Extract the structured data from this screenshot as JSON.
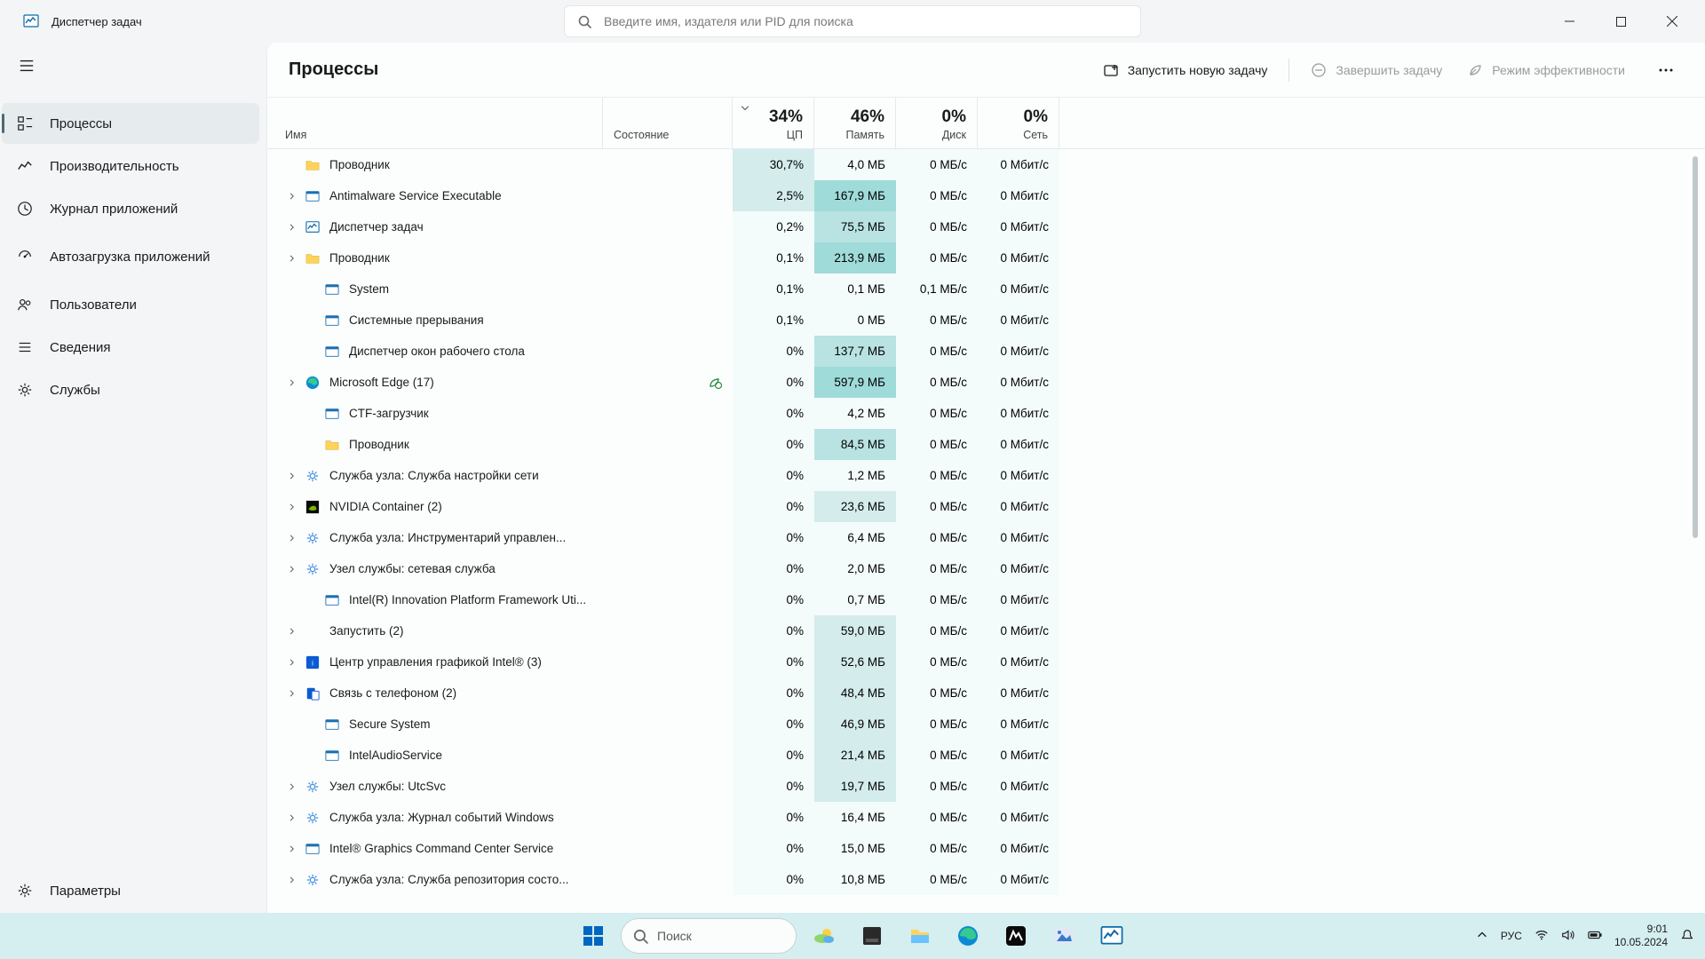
{
  "window": {
    "title": "Диспетчер задач"
  },
  "search": {
    "placeholder": "Введите имя, издателя или PID для поиска"
  },
  "sidebar": {
    "items": [
      {
        "label": "Процессы",
        "active": true,
        "icon": "processes"
      },
      {
        "label": "Производительность",
        "active": false,
        "icon": "performance"
      },
      {
        "label": "Журнал приложений",
        "active": false,
        "icon": "history"
      },
      {
        "label": "Автозагрузка приложений",
        "active": false,
        "icon": "startup"
      },
      {
        "label": "Пользователи",
        "active": false,
        "icon": "users"
      },
      {
        "label": "Сведения",
        "active": false,
        "icon": "details"
      },
      {
        "label": "Службы",
        "active": false,
        "icon": "services"
      }
    ],
    "settings_label": "Параметры"
  },
  "commands": {
    "title": "Процессы",
    "new_task": "Запустить новую задачу",
    "end_task": "Завершить задачу",
    "eff_mode": "Режим эффективности"
  },
  "headers": {
    "name": "Имя",
    "status": "Состояние",
    "cpu_pct": "34%",
    "cpu_label": "ЦП",
    "mem_pct": "46%",
    "mem_label": "Память",
    "disk_pct": "0%",
    "disk_label": "Диск",
    "net_pct": "0%",
    "net_label": "Сеть"
  },
  "rows": [
    {
      "icon": "folder",
      "name": "Проводник",
      "cpu": "30,7%",
      "mem": "4,0 МБ",
      "disk": "0 МБ/с",
      "net": "0 Мбит/с",
      "expand": false,
      "leaf": false,
      "cpu_h": 1,
      "mem_h": 0
    },
    {
      "icon": "exe",
      "name": "Antimalware Service Executable",
      "cpu": "2,5%",
      "mem": "167,9 МБ",
      "disk": "0 МБ/с",
      "net": "0 Мбит/с",
      "expand": true,
      "leaf": false,
      "cpu_h": 1,
      "mem_h": 3
    },
    {
      "icon": "tm",
      "name": "Диспетчер задач",
      "cpu": "0,2%",
      "mem": "75,5 МБ",
      "disk": "0 МБ/с",
      "net": "0 Мбит/с",
      "expand": true,
      "leaf": false,
      "cpu_h": 0,
      "mem_h": 2
    },
    {
      "icon": "folder",
      "name": "Проводник",
      "cpu": "0,1%",
      "mem": "213,9 МБ",
      "disk": "0 МБ/с",
      "net": "0 Мбит/с",
      "expand": true,
      "leaf": false,
      "cpu_h": 0,
      "mem_h": 3
    },
    {
      "icon": "exe",
      "name": "System",
      "cpu": "0,1%",
      "mem": "0,1 МБ",
      "disk": "0,1 МБ/с",
      "net": "0 Мбит/с",
      "expand": false,
      "leaf": true,
      "cpu_h": 0,
      "mem_h": 0
    },
    {
      "icon": "exe",
      "name": "Системные прерывания",
      "cpu": "0,1%",
      "mem": "0 МБ",
      "disk": "0 МБ/с",
      "net": "0 Мбит/с",
      "expand": false,
      "leaf": true,
      "cpu_h": 0,
      "mem_h": 0
    },
    {
      "icon": "exe",
      "name": "Диспетчер окон рабочего стола",
      "cpu": "0%",
      "mem": "137,7 МБ",
      "disk": "0 МБ/с",
      "net": "0 Мбит/с",
      "expand": false,
      "leaf": true,
      "cpu_h": 0,
      "mem_h": 2
    },
    {
      "icon": "edge",
      "name": "Microsoft Edge (17)",
      "cpu": "0%",
      "mem": "597,9 МБ",
      "disk": "0 МБ/с",
      "net": "0 Мбит/с",
      "expand": true,
      "leaf": false,
      "eff": true,
      "cpu_h": 0,
      "mem_h": 3
    },
    {
      "icon": "exe",
      "name": "CTF-загрузчик",
      "cpu": "0%",
      "mem": "4,2 МБ",
      "disk": "0 МБ/с",
      "net": "0 Мбит/с",
      "expand": false,
      "leaf": true,
      "cpu_h": 0,
      "mem_h": 0
    },
    {
      "icon": "folder",
      "name": "Проводник",
      "cpu": "0%",
      "mem": "84,5 МБ",
      "disk": "0 МБ/с",
      "net": "0 Мбит/с",
      "expand": false,
      "leaf": true,
      "cpu_h": 0,
      "mem_h": 2
    },
    {
      "icon": "svc",
      "name": "Служба узла: Служба настройки сети",
      "cpu": "0%",
      "mem": "1,2 МБ",
      "disk": "0 МБ/с",
      "net": "0 Мбит/с",
      "expand": true,
      "leaf": false,
      "cpu_h": 0,
      "mem_h": 0
    },
    {
      "icon": "nvidia",
      "name": "NVIDIA Container (2)",
      "cpu": "0%",
      "mem": "23,6 МБ",
      "disk": "0 МБ/с",
      "net": "0 Мбит/с",
      "expand": true,
      "leaf": false,
      "cpu_h": 0,
      "mem_h": 1
    },
    {
      "icon": "svc",
      "name": "Служба узла: Инструментарий управлен...",
      "cpu": "0%",
      "mem": "6,4 МБ",
      "disk": "0 МБ/с",
      "net": "0 Мбит/с",
      "expand": true,
      "leaf": false,
      "cpu_h": 0,
      "mem_h": 0
    },
    {
      "icon": "svc",
      "name": "Узел службы: сетевая служба",
      "cpu": "0%",
      "mem": "2,0 МБ",
      "disk": "0 МБ/с",
      "net": "0 Мбит/с",
      "expand": true,
      "leaf": false,
      "cpu_h": 0,
      "mem_h": 0
    },
    {
      "icon": "exe",
      "name": "Intel(R) Innovation Platform Framework Uti...",
      "cpu": "0%",
      "mem": "0,7 МБ",
      "disk": "0 МБ/с",
      "net": "0 Мбит/с",
      "expand": false,
      "leaf": true,
      "cpu_h": 0,
      "mem_h": 0
    },
    {
      "icon": "",
      "name": "Запустить (2)",
      "cpu": "0%",
      "mem": "59,0 МБ",
      "disk": "0 МБ/с",
      "net": "0 Мбит/с",
      "expand": true,
      "leaf": false,
      "cpu_h": 0,
      "mem_h": 1
    },
    {
      "icon": "intel",
      "name": "Центр управления графикой Intel® (3)",
      "cpu": "0%",
      "mem": "52,6 МБ",
      "disk": "0 МБ/с",
      "net": "0 Мбит/с",
      "expand": true,
      "leaf": false,
      "cpu_h": 0,
      "mem_h": 1
    },
    {
      "icon": "phone",
      "name": "Связь с телефоном (2)",
      "cpu": "0%",
      "mem": "48,4 МБ",
      "disk": "0 МБ/с",
      "net": "0 Мбит/с",
      "expand": true,
      "leaf": false,
      "cpu_h": 0,
      "mem_h": 1
    },
    {
      "icon": "exe",
      "name": "Secure System",
      "cpu": "0%",
      "mem": "46,9 МБ",
      "disk": "0 МБ/с",
      "net": "0 Мбит/с",
      "expand": false,
      "leaf": true,
      "cpu_h": 0,
      "mem_h": 1
    },
    {
      "icon": "exe",
      "name": "IntelAudioService",
      "cpu": "0%",
      "mem": "21,4 МБ",
      "disk": "0 МБ/с",
      "net": "0 Мбит/с",
      "expand": false,
      "leaf": true,
      "cpu_h": 0,
      "mem_h": 1
    },
    {
      "icon": "svc",
      "name": "Узел службы: UtcSvc",
      "cpu": "0%",
      "mem": "19,7 МБ",
      "disk": "0 МБ/с",
      "net": "0 Мбит/с",
      "expand": true,
      "leaf": false,
      "cpu_h": 0,
      "mem_h": 1
    },
    {
      "icon": "svc",
      "name": "Служба узла: Журнал событий Windows",
      "cpu": "0%",
      "mem": "16,4 МБ",
      "disk": "0 МБ/с",
      "net": "0 Мбит/с",
      "expand": true,
      "leaf": false,
      "cpu_h": 0,
      "mem_h": 0
    },
    {
      "icon": "exe",
      "name": "Intel® Graphics Command Center Service",
      "cpu": "0%",
      "mem": "15,0 МБ",
      "disk": "0 МБ/с",
      "net": "0 Мбит/с",
      "expand": true,
      "leaf": false,
      "cpu_h": 0,
      "mem_h": 0
    },
    {
      "icon": "svc",
      "name": "Служба узла: Служба репозитория состо...",
      "cpu": "0%",
      "mem": "10,8 МБ",
      "disk": "0 МБ/с",
      "net": "0 Мбит/с",
      "expand": true,
      "leaf": false,
      "cpu_h": 0,
      "mem_h": 0
    }
  ],
  "taskbar": {
    "search": "Поиск",
    "lang": "РУС",
    "time": "9:01",
    "date": "10.05.2024"
  }
}
